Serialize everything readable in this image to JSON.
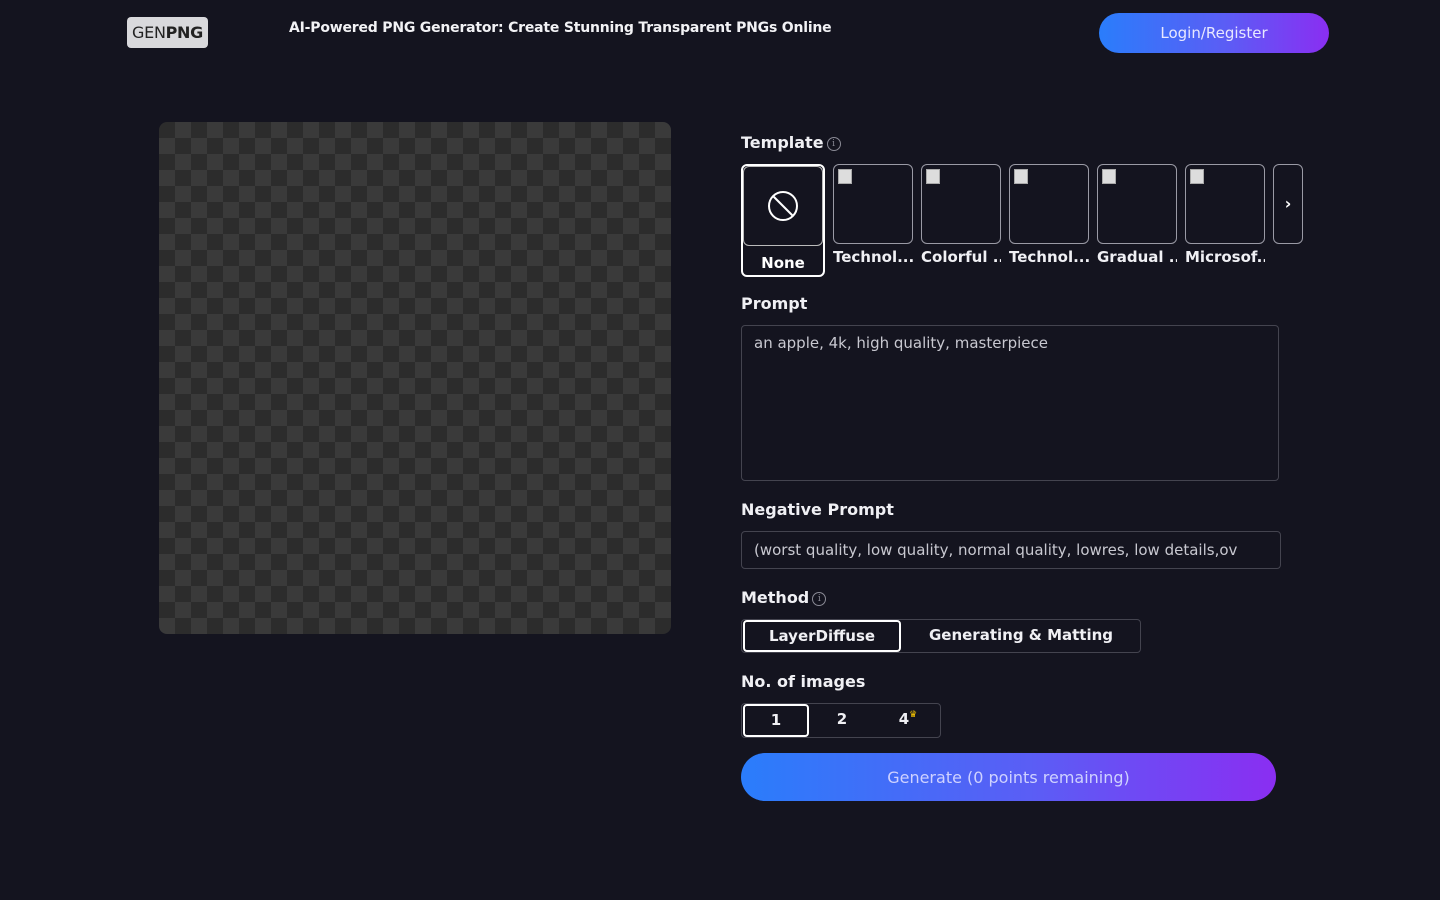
{
  "header": {
    "logo_gen": "GEN",
    "logo_png": "PNG",
    "title": "AI-Powered PNG Generator: Create Stunning Transparent PNGs Online",
    "login_label": "Login/Register"
  },
  "template": {
    "label": "Template",
    "info": "i",
    "none_label": "None",
    "items": [
      {
        "name": "Technol..."
      },
      {
        "name": "Colorful ..."
      },
      {
        "name": "Technol..."
      },
      {
        "name": "Gradual ..."
      },
      {
        "name": "Microsof..."
      }
    ],
    "next": "›"
  },
  "prompt": {
    "label": "Prompt",
    "value": "an apple, 4k, high quality, masterpiece"
  },
  "negative_prompt": {
    "label": "Negative Prompt",
    "value": "(worst quality, low quality, normal quality, lowres, low details,ov"
  },
  "method": {
    "label": "Method",
    "info": "i",
    "options": [
      "LayerDiffuse",
      "Generating & Matting"
    ],
    "selected": "LayerDiffuse"
  },
  "num_images": {
    "label": "No. of images",
    "options": [
      "1",
      "2",
      "4"
    ],
    "selected": "1"
  },
  "generate_label": "Generate (0 points remaining)"
}
